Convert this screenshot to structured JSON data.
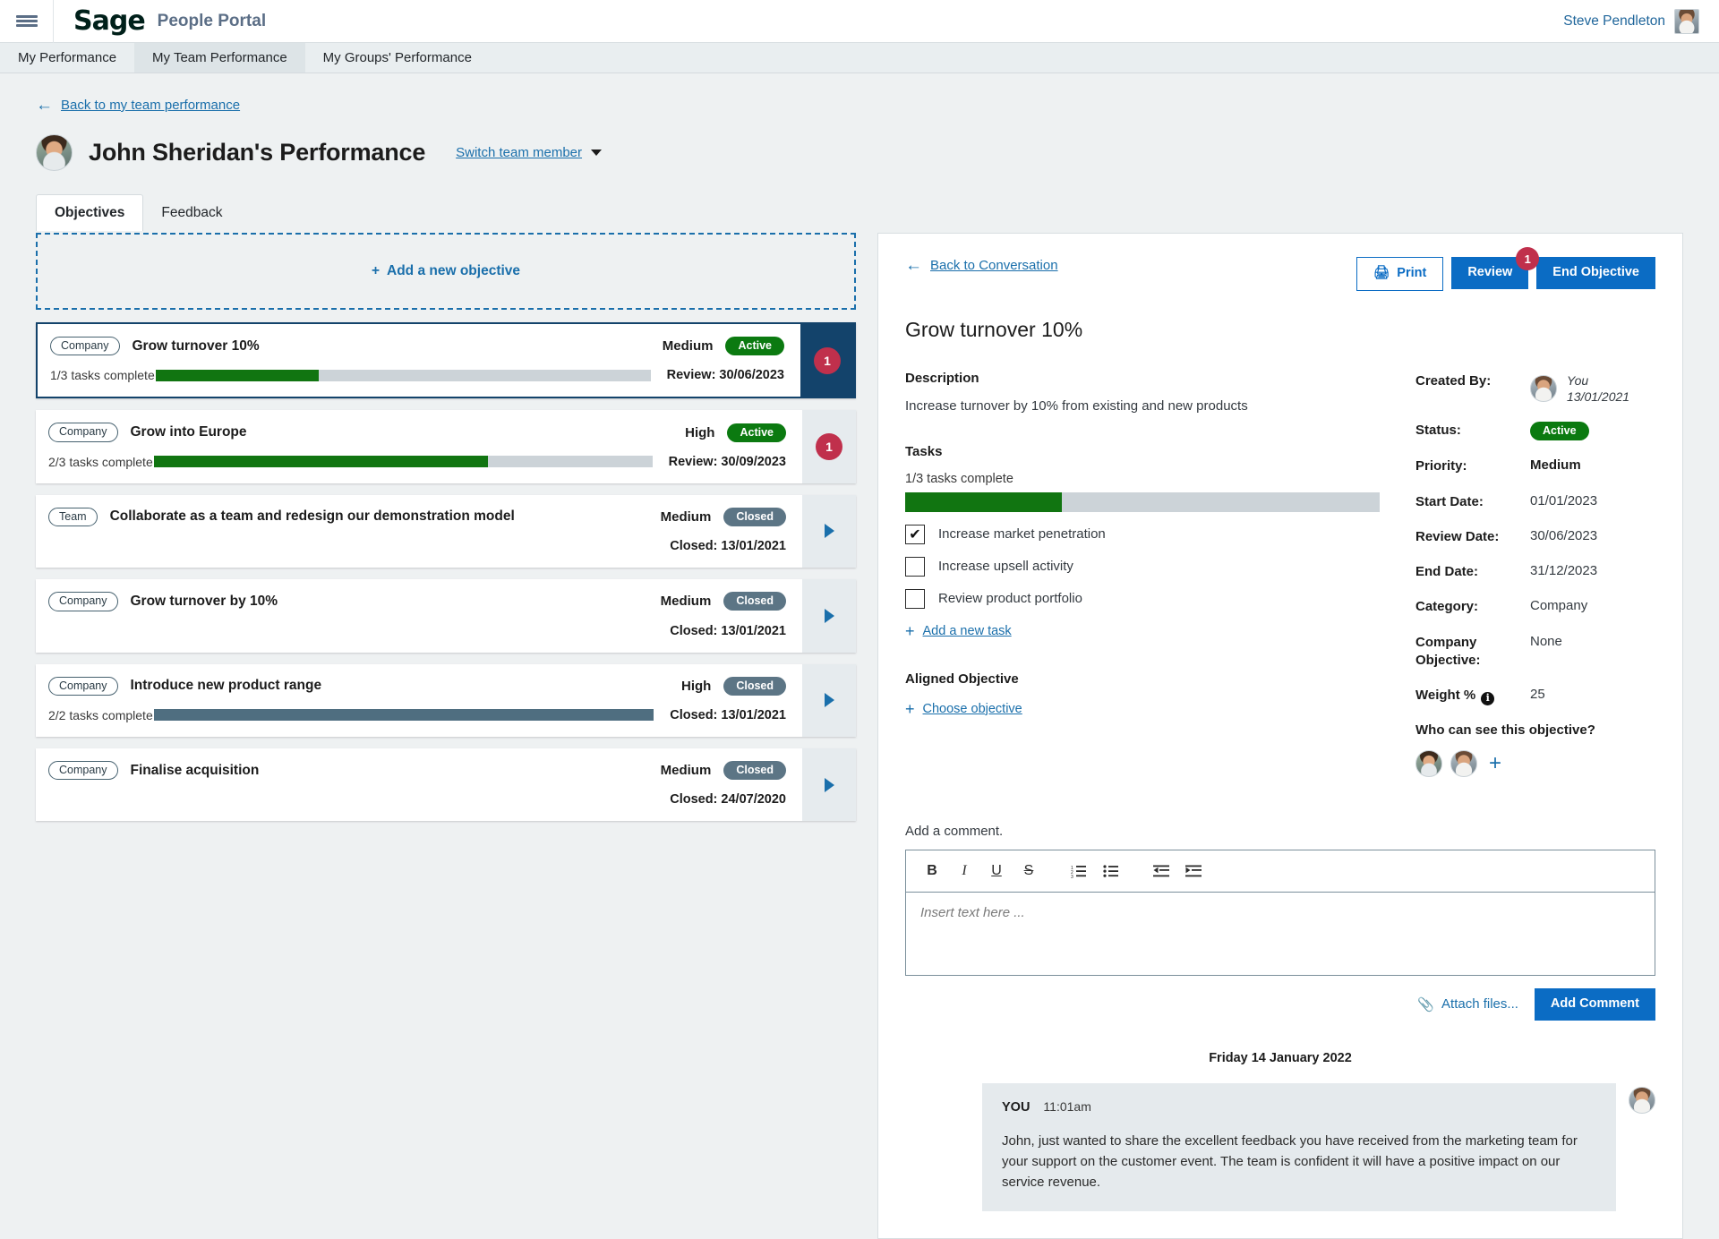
{
  "header": {
    "menu_icon": "hamburger-menu-icon",
    "logo_text": "Sage",
    "portal_name": "People Portal",
    "user_name": "Steve Pendleton",
    "user_avatar": "steve-pendleton-avatar"
  },
  "nav_tabs": [
    {
      "label": "My Performance",
      "active": false
    },
    {
      "label": "My Team Performance",
      "active": true
    },
    {
      "label": "My Groups' Performance",
      "active": false
    }
  ],
  "back_link": {
    "label": "Back to my team performance",
    "icon": "arrow-left-icon"
  },
  "page_title": "John Sheridan's Performance",
  "switch_member": {
    "label": "Switch team member",
    "icon": "chevron-down-icon"
  },
  "sub_tabs": [
    {
      "label": "Objectives",
      "active": true
    },
    {
      "label": "Feedback",
      "active": false
    }
  ],
  "add_objective": {
    "plus": "+",
    "label": "Add a new objective"
  },
  "objectives": [
    {
      "tag": "Company",
      "title": "Grow turnover 10%",
      "priority": "Medium",
      "status": "Active",
      "status_kind": "active",
      "tasks_text": "1/3 tasks complete",
      "progress_pct": 33,
      "progress_color": "green",
      "date_label": "Review: 30/06/2023",
      "selected": true,
      "side_kind": "count",
      "count": "1"
    },
    {
      "tag": "Company",
      "title": "Grow into Europe",
      "priority": "High",
      "status": "Active",
      "status_kind": "active",
      "tasks_text": "2/3 tasks complete",
      "progress_pct": 67,
      "progress_color": "green",
      "date_label": "Review: 30/09/2023",
      "selected": false,
      "side_kind": "count",
      "count": "1"
    },
    {
      "tag": "Team",
      "title": "Collaborate as a team and redesign our demonstration model",
      "priority": "Medium",
      "status": "Closed",
      "status_kind": "closed",
      "tasks_text": "",
      "progress_pct": null,
      "progress_color": "",
      "date_label": "Closed: 13/01/2021",
      "selected": false,
      "side_kind": "chevron",
      "count": ""
    },
    {
      "tag": "Company",
      "title": "Grow turnover by 10%",
      "priority": "Medium",
      "status": "Closed",
      "status_kind": "closed",
      "tasks_text": "",
      "progress_pct": null,
      "progress_color": "",
      "date_label": "Closed: 13/01/2021",
      "selected": false,
      "side_kind": "chevron",
      "count": ""
    },
    {
      "tag": "Company",
      "title": "Introduce new product range",
      "priority": "High",
      "status": "Closed",
      "status_kind": "closed",
      "tasks_text": "2/2 tasks complete",
      "progress_pct": 100,
      "progress_color": "slate",
      "date_label": "Closed: 13/01/2021",
      "selected": false,
      "side_kind": "chevron",
      "count": ""
    },
    {
      "tag": "Company",
      "title": "Finalise acquisition",
      "priority": "Medium",
      "status": "Closed",
      "status_kind": "closed",
      "tasks_text": "",
      "progress_pct": null,
      "progress_color": "",
      "date_label": "Closed: 24/07/2020",
      "selected": false,
      "side_kind": "chevron",
      "count": ""
    }
  ],
  "detail": {
    "back_link": {
      "label": "Back to Conversation",
      "icon": "arrow-left-icon"
    },
    "print_button": {
      "label": "Print",
      "icon": "printer-icon"
    },
    "review_button": {
      "label": "Review",
      "badge": "1"
    },
    "end_button": {
      "label": "End Objective"
    },
    "title": "Grow turnover 10%",
    "description_label": "Description",
    "description_text": "Increase turnover by 10% from existing and new products",
    "tasks_label": "Tasks",
    "tasks_progress_text": "1/3 tasks complete",
    "tasks_progress_pct": 33,
    "tasks": [
      {
        "label": "Increase market penetration",
        "checked": true
      },
      {
        "label": "Increase upsell activity",
        "checked": false
      },
      {
        "label": "Review product portfolio",
        "checked": false
      }
    ],
    "add_task_link": "Add a new task",
    "aligned_label": "Aligned Objective",
    "choose_objective_link": "Choose objective",
    "meta": {
      "created_by_label": "Created By:",
      "created_by_value": "You",
      "created_by_date": "13/01/2021",
      "status_label": "Status:",
      "status_value": "Active",
      "priority_label": "Priority:",
      "priority_value": "Medium",
      "start_label": "Start Date:",
      "start_value": "01/01/2023",
      "review_label": "Review Date:",
      "review_value": "30/06/2023",
      "end_label": "End Date:",
      "end_value": "31/12/2023",
      "category_label": "Category:",
      "category_value": "Company",
      "company_obj_label": "Company Objective:",
      "company_obj_value": "None",
      "weight_label": "Weight %",
      "weight_value": "25",
      "who_label": "Who can see this objective?",
      "who_add": "+"
    },
    "comment": {
      "label": "Add a comment.",
      "placeholder": "Insert text here ...",
      "toolbar": [
        {
          "name": "bold-icon",
          "glyph": "B",
          "cls": "b"
        },
        {
          "name": "italic-icon",
          "glyph": "I",
          "cls": "i"
        },
        {
          "name": "underline-icon",
          "glyph": "U",
          "cls": "u"
        },
        {
          "name": "strikethrough-icon",
          "glyph": "S",
          "cls": "s"
        },
        {
          "name": "ordered-list-icon",
          "glyph": "☰",
          "cls": "ol"
        },
        {
          "name": "unordered-list-icon",
          "glyph": "☰",
          "cls": "ul"
        },
        {
          "name": "outdent-icon",
          "glyph": "⇤",
          "cls": "out"
        },
        {
          "name": "indent-icon",
          "glyph": "⇥",
          "cls": "ind"
        }
      ],
      "attach_label": "Attach files...",
      "attach_icon": "paperclip-icon",
      "submit_label": "Add Comment"
    },
    "thread": {
      "date": "Friday 14 January 2022",
      "messages": [
        {
          "author": "YOU",
          "time": "11:01am",
          "text": "John, just wanted to share the excellent feedback you have received from the marketing team for your support on the customer event. The team is confident it will have a positive impact on our service revenue."
        }
      ]
    }
  },
  "colors": {
    "brand_blue": "#0b6cc4",
    "link_blue": "#1a6fab",
    "selected_navy": "#13436b",
    "active_green": "#0b7a10",
    "closed_slate": "#5c7585",
    "badge_red": "#c0304c",
    "progress_green": "#117511",
    "progress_slate": "#4f6e80"
  }
}
